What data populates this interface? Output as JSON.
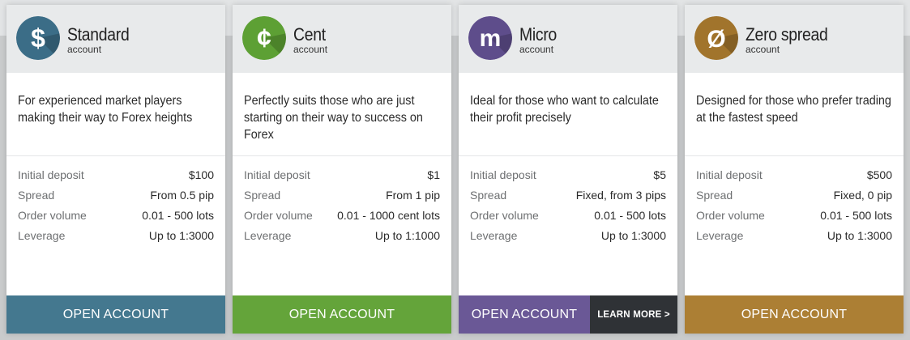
{
  "spec_labels": {
    "deposit": "Initial deposit",
    "spread": "Spread",
    "volume": "Order volume",
    "leverage": "Leverage"
  },
  "cards": [
    {
      "name": "Standard",
      "subtitle": "account",
      "logo_symbol": "$",
      "logo_icon": "dollar-icon",
      "accent": "#44788f",
      "logo_color": "#3b6d87",
      "description": "For experienced market players making their way to Forex heights",
      "deposit": "$100",
      "spread": "From 0.5 pip",
      "volume": "0.01 - 500 lots",
      "leverage": "Up to 1:3000",
      "cta": "OPEN ACCOUNT"
    },
    {
      "name": "Cent",
      "subtitle": "account",
      "logo_symbol": "¢",
      "logo_icon": "cent-icon",
      "accent": "#64a43a",
      "logo_color": "#5da034",
      "description": "Perfectly suits those who are just starting on their way to success on Forex",
      "deposit": "$1",
      "spread": "From 1 pip",
      "volume": "0.01 - 1000 cent lots",
      "leverage": "Up to 1:1000",
      "cta": "OPEN ACCOUNT"
    },
    {
      "name": "Micro",
      "subtitle": "account",
      "logo_symbol": "m",
      "logo_icon": "micro-m-icon",
      "accent": "#6a5896",
      "logo_color": "#5e4d8b",
      "description": "Ideal for those who want to calculate their profit precisely",
      "deposit": "$5",
      "spread": "Fixed, from 3 pips",
      "volume": "0.01 - 500 lots",
      "leverage": "Up to 1:3000",
      "cta": "OPEN ACCOUNT",
      "learn_more": "LEARN MORE >",
      "learn_more_bg": "#2f3236"
    },
    {
      "name": "Zero spread",
      "subtitle": "account",
      "logo_symbol": "Ø",
      "logo_icon": "zero-slash-icon",
      "accent": "#ac7f34",
      "logo_color": "#a1742c",
      "description": "Designed for those who prefer trading at the fastest speed",
      "deposit": "$500",
      "spread": "Fixed, 0 pip",
      "volume": "0.01 - 500 lots",
      "leverage": "Up to 1:3000",
      "cta": "OPEN ACCOUNT"
    }
  ]
}
